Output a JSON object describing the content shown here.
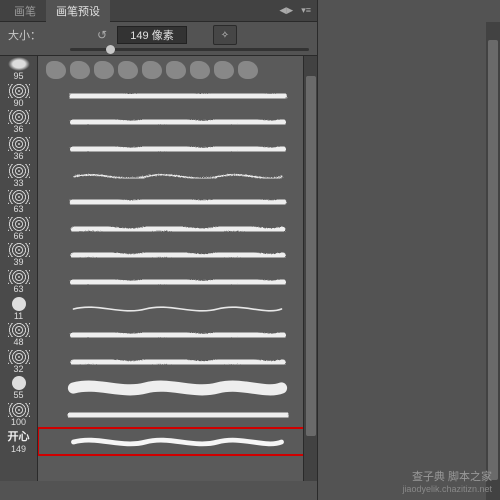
{
  "tabs": {
    "brush": "画笔",
    "presets": "画笔预设"
  },
  "menu": {
    "collapse": "◀▶",
    "options": "▾≡"
  },
  "size": {
    "label": "大小：",
    "value": "149 像素",
    "reset": "↺",
    "toggle": "✧"
  },
  "brushes": [
    {
      "size": "95",
      "type": "blob"
    },
    {
      "size": "90",
      "type": "sp"
    },
    {
      "size": "36",
      "type": "sp"
    },
    {
      "size": "36",
      "type": "sp"
    },
    {
      "size": "33",
      "type": "sp"
    },
    {
      "size": "63",
      "type": "sp"
    },
    {
      "size": "66",
      "type": "sp"
    },
    {
      "size": "39",
      "type": "sp"
    },
    {
      "size": "63",
      "type": "sp"
    },
    {
      "size": "11",
      "type": "dot"
    },
    {
      "size": "48",
      "type": "sp"
    },
    {
      "size": "32",
      "type": "sp"
    },
    {
      "size": "55",
      "type": "dot"
    },
    {
      "size": "100",
      "type": "sp"
    },
    {
      "size": "149",
      "type": "text",
      "label": "开心"
    }
  ],
  "selected_index": 14,
  "watermark": {
    "line1": "查子典 脚本之家",
    "line2": "jiaodyelik.chazitizn.net"
  }
}
